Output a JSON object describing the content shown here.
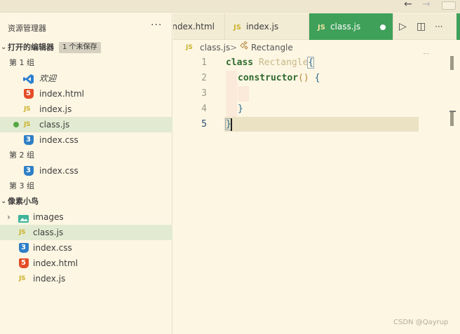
{
  "titlebar": {
    "back_icon": "←",
    "forward_icon": "→"
  },
  "sidebar": {
    "title": "资源管理器",
    "more_icon": "···",
    "open_editors": {
      "label": "打开的编辑器",
      "badge": "1 个未保存",
      "groups": [
        {
          "label": "第 1 组",
          "items": [
            {
              "name": "欢迎",
              "icon": "vscode-icon"
            },
            {
              "name": "index.html",
              "icon": "html-icon"
            },
            {
              "name": "index.js",
              "icon": "js-icon"
            },
            {
              "name": "class.js",
              "icon": "js-icon",
              "unsaved": true
            },
            {
              "name": "index.css",
              "icon": "css-icon"
            }
          ]
        },
        {
          "label": "第 2 组",
          "items": [
            {
              "name": "index.css",
              "icon": "css-icon"
            }
          ]
        },
        {
          "label": "第 3 组",
          "items": []
        }
      ]
    },
    "workspace": {
      "label": "像素小鸟",
      "items": [
        {
          "name": "images",
          "icon": "image-folder-icon"
        },
        {
          "name": "class.js",
          "icon": "js-icon"
        },
        {
          "name": "index.css",
          "icon": "css-icon"
        },
        {
          "name": "index.html",
          "icon": "html-icon"
        },
        {
          "name": "index.js",
          "icon": "js-icon"
        }
      ]
    }
  },
  "tabs": [
    {
      "label": "index.html"
    },
    {
      "label": "index.js",
      "badge": "JS"
    },
    {
      "label": "class.js",
      "badge": "JS",
      "active": true,
      "unsaved": true
    }
  ],
  "tab_actions": {
    "run_icon": "▷",
    "split_icon": "◫",
    "more_icon": "···"
  },
  "breadcrumb": {
    "badge": "JS",
    "file": "class.js",
    "separator": ">",
    "symbol": "Rectangle"
  },
  "code": {
    "line_numbers": [
      "1",
      "2",
      "3",
      "4",
      "5"
    ],
    "line1": {
      "kw": "class",
      "name": "Rectangle",
      "brace": "{"
    },
    "line2": {
      "fn": "constructor",
      "paren": "()",
      "brace": "{"
    },
    "line4": {
      "brace": "}"
    },
    "line5": {
      "brace": "}"
    }
  },
  "watermark": "CSDN @Qayrup",
  "colors": {
    "accent": "#3fa05a",
    "background": "#fdf6e3",
    "selection": "#e2ebd2"
  }
}
